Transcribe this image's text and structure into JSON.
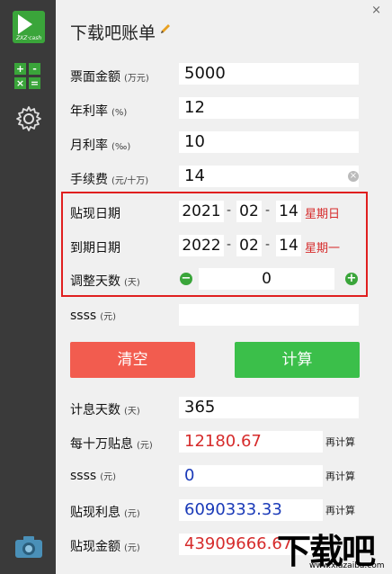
{
  "window": {
    "title": "下载吧账单",
    "close_symbol": "×"
  },
  "sidebar": {
    "logo_text": "ZXZ·cash",
    "calc_icon": [
      "+",
      "-",
      "×",
      "="
    ]
  },
  "fields": {
    "face_amount": {
      "label": "票面金额",
      "unit": "(万元)",
      "value": "5000"
    },
    "annual_rate": {
      "label": "年利率",
      "unit": "(%)",
      "value": "12"
    },
    "monthly_rate": {
      "label": "月利率",
      "unit": "(‰)",
      "value": "10"
    },
    "fee": {
      "label": "手续费",
      "unit": "(元/十万)",
      "value": "14"
    },
    "discount_date": {
      "label": "贴现日期",
      "year": "2021",
      "month": "02",
      "day": "14",
      "weekday": "星期日"
    },
    "due_date": {
      "label": "到期日期",
      "year": "2022",
      "month": "02",
      "day": "14",
      "weekday": "星期一"
    },
    "adjust_days": {
      "label": "调整天数",
      "unit": "(天)",
      "value": "0",
      "minus": "−",
      "plus": "+"
    },
    "ssss_top": {
      "label": "ssss",
      "unit": "(元)",
      "value": ""
    }
  },
  "buttons": {
    "clear": "清空",
    "calculate": "计算"
  },
  "results": {
    "interest_days": {
      "label": "计息天数",
      "unit": "(天)",
      "value": "365"
    },
    "per_100k": {
      "label": "每十万贴息",
      "unit": "(元)",
      "value": "12180.67",
      "recalc": "再计算"
    },
    "ssss": {
      "label": "ssss",
      "unit": "(元)",
      "value": "0",
      "recalc": "再计算"
    },
    "discount_interest": {
      "label": "贴现利息",
      "unit": "(元)",
      "value": "6090333.33",
      "recalc": "再计算"
    },
    "discount_amount": {
      "label": "贴现金额",
      "unit": "(元)",
      "value": "43909666.67"
    }
  },
  "watermark": {
    "text": "下载吧",
    "url": "www.xiazaiba.com"
  },
  "colors": {
    "accent_green": "#3aa53a",
    "clear_red": "#f25c4f",
    "calc_green": "#3bbf4a",
    "highlight_red": "#e01f1f",
    "value_red": "#d62b2b",
    "value_blue": "#1a3ab8"
  },
  "dash": "-"
}
